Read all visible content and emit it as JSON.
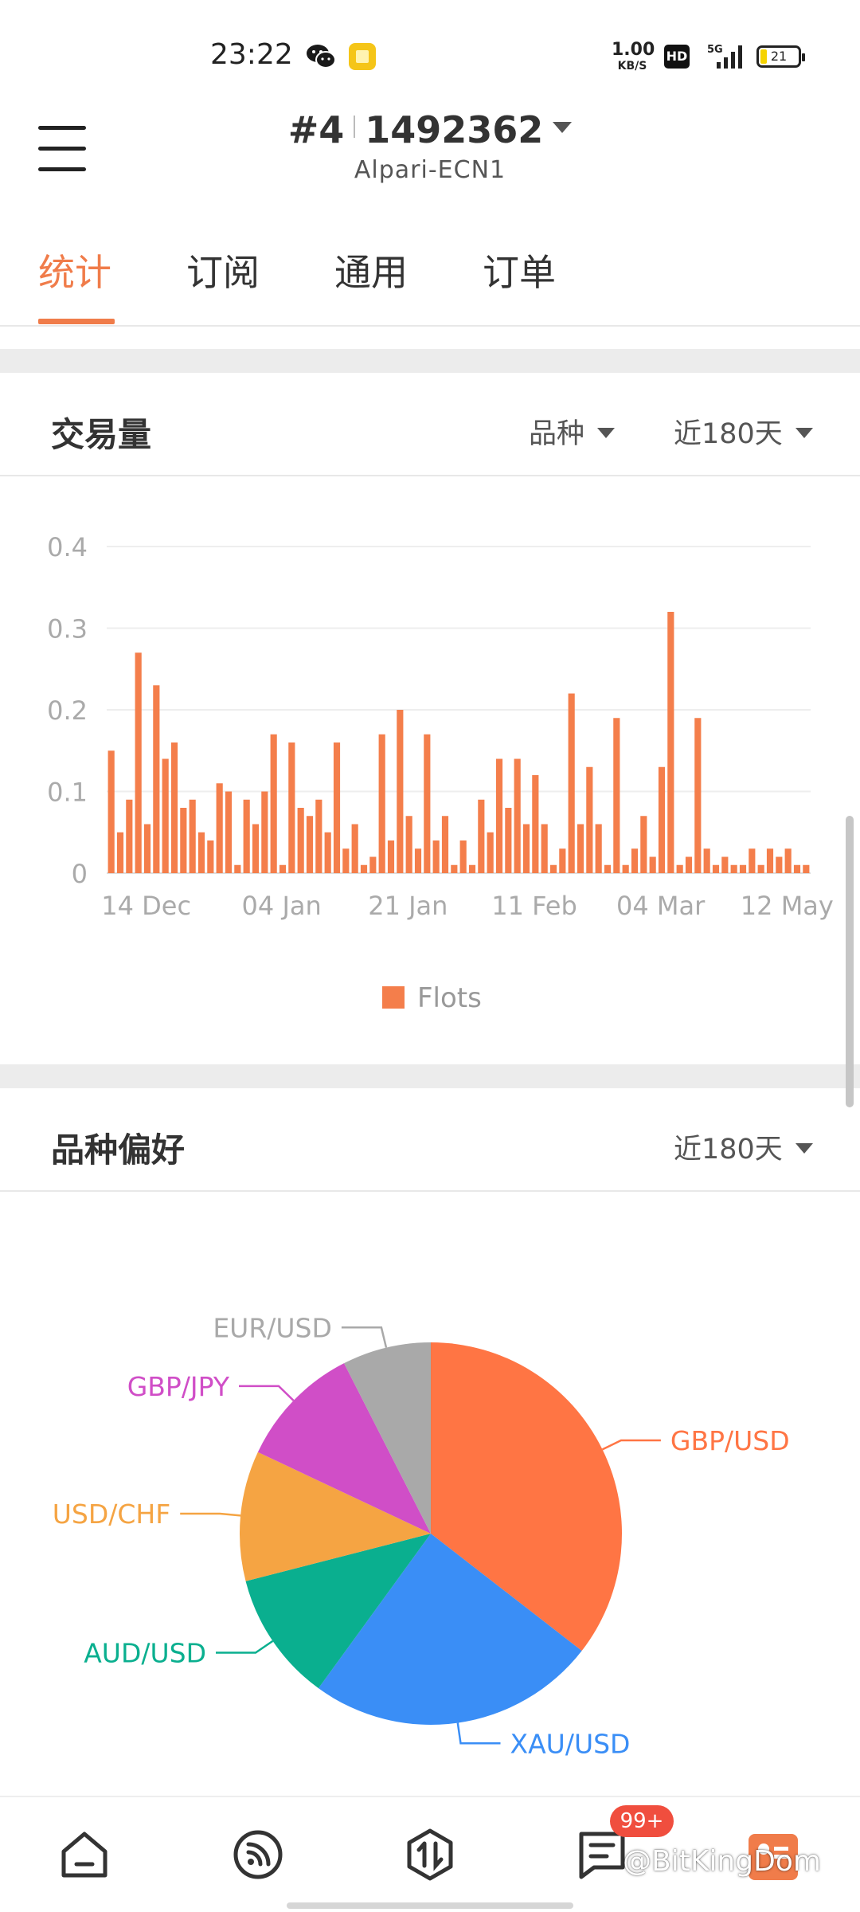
{
  "status_bar": {
    "time": "23:22",
    "net_speed_value": "1.00",
    "net_speed_unit": "KB/S",
    "hd_badge": "HD",
    "network": "5G",
    "battery": "21",
    "icons": [
      "wechat-icon",
      "notes-app-icon",
      "signal-5g-icon",
      "battery-icon"
    ]
  },
  "header": {
    "account_number": "#4",
    "account_id": "1492362",
    "server": "Alpari-ECN1"
  },
  "tabs": [
    {
      "label": "统计",
      "active": true
    },
    {
      "label": "订阅",
      "active": false
    },
    {
      "label": "通用",
      "active": false
    },
    {
      "label": "订单",
      "active": false
    }
  ],
  "volume_section": {
    "title": "交易量",
    "filter_symbol": "品种",
    "filter_period": "近180天"
  },
  "preference_section": {
    "title": "品种偏好",
    "filter_period": "近180天"
  },
  "colors": {
    "accent": "#f07c4a",
    "bar": "#f47e4b",
    "badge": "#f04e3e"
  },
  "chart_data": [
    {
      "type": "bar",
      "x_tick_labels": [
        "14 Dec",
        "04 Jan",
        "21 Jan",
        "11 Feb",
        "04 Mar",
        "12 May"
      ],
      "x_tick_bar_index": [
        0,
        15,
        29,
        43,
        57,
        71
      ],
      "values": [
        0.15,
        0.05,
        0.09,
        0.27,
        0.06,
        0.23,
        0.14,
        0.16,
        0.08,
        0.09,
        0.05,
        0.04,
        0.11,
        0.1,
        0.01,
        0.09,
        0.06,
        0.1,
        0.17,
        0.01,
        0.16,
        0.08,
        0.07,
        0.09,
        0.05,
        0.16,
        0.03,
        0.06,
        0.01,
        0.02,
        0.17,
        0.04,
        0.2,
        0.07,
        0.03,
        0.17,
        0.04,
        0.07,
        0.01,
        0.04,
        0.01,
        0.09,
        0.05,
        0.14,
        0.08,
        0.14,
        0.06,
        0.12,
        0.06,
        0.01,
        0.03,
        0.22,
        0.06,
        0.13,
        0.06,
        0.01,
        0.19,
        0.01,
        0.03,
        0.07,
        0.02,
        0.13,
        0.32,
        0.01,
        0.02,
        0.19,
        0.03,
        0.01,
        0.02,
        0.01,
        0.01,
        0.03,
        0.01,
        0.03,
        0.02,
        0.03,
        0.01,
        0.01
      ],
      "y_ticks": [
        0,
        0.1,
        0.2,
        0.3,
        0.4
      ],
      "ylim": [
        0,
        0.4
      ],
      "grid": true,
      "legend": "bottom-center",
      "series": [
        {
          "name": "Flots",
          "color": "#f47e4b"
        }
      ]
    },
    {
      "type": "pie",
      "labels": [
        "GBP/USD",
        "XAU/USD",
        "AUD/USD",
        "USD/CHF",
        "GBP/JPY",
        "EUR/USD"
      ],
      "values": [
        35.5,
        24.5,
        11,
        11,
        10.5,
        7.5
      ],
      "colors": [
        "#ff7544",
        "#3a8ef6",
        "#0aaf8f",
        "#f5a443",
        "#d04ec7",
        "#a9a9a9"
      ],
      "legend": "none"
    }
  ]
}
